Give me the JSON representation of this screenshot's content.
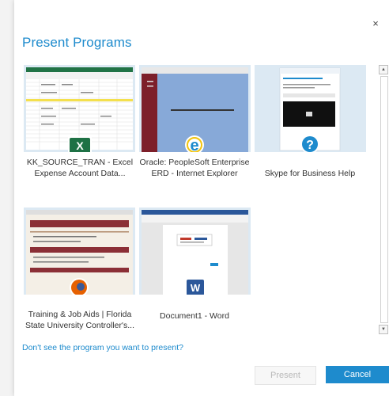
{
  "dialog": {
    "title": "Present Programs",
    "close_glyph": "×",
    "help_link": "Don't see the program you want to present?",
    "present_label": "Present",
    "cancel_label": "Cancel"
  },
  "programs": [
    {
      "label_line1": "KK_SOURCE_TRAN - Excel",
      "label_line2": "Expense Account Data...",
      "icon": "excel-icon",
      "icon_letter": "X",
      "icon_color": "#1e7145"
    },
    {
      "label_line1": "Oracle: PeopleSoft Enterprise",
      "label_line2": "ERD - Internet Explorer",
      "icon": "internet-explorer-icon",
      "icon_letter": "e",
      "icon_color": "#1e8bcd"
    },
    {
      "label_line1": "Skype for Business Help",
      "label_line2": "",
      "icon": "help-icon",
      "icon_letter": "?",
      "icon_color": "#1e8bcd"
    },
    {
      "label_line1": "Training & Job Aids | Florida",
      "label_line2": "State University  Controller's...",
      "icon": "firefox-icon",
      "icon_letter": "",
      "icon_color": "#e66000"
    },
    {
      "label_line1": "Document1 - Word",
      "label_line2": "",
      "icon": "word-icon",
      "icon_letter": "W",
      "icon_color": "#2b579a"
    }
  ],
  "scrollbar": {
    "up_glyph": "▲",
    "down_glyph": "▼"
  },
  "colors": {
    "accent": "#1e8bcd",
    "tile_bg": "#dce9f3"
  }
}
